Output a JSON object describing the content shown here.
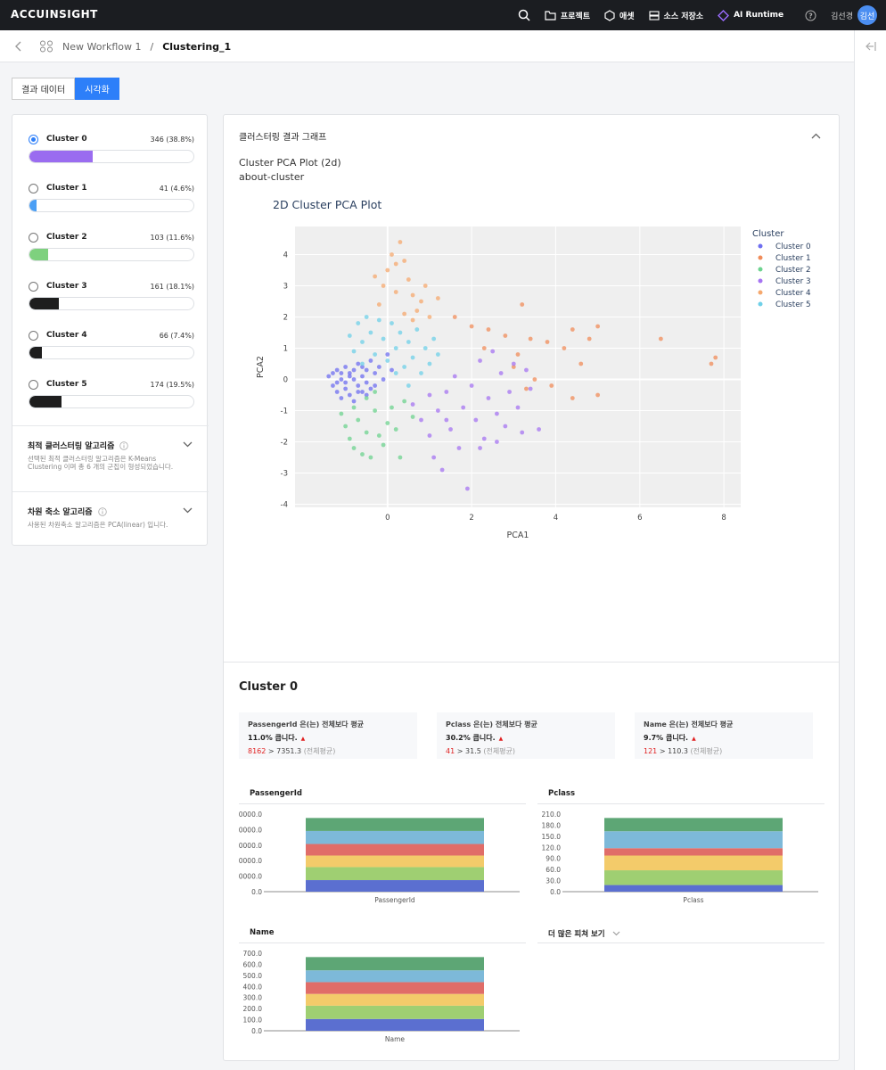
{
  "app": {
    "logo": "ACCUINSIGHT",
    "nav": [
      {
        "label": "",
        "icon": "search-icon"
      },
      {
        "label": "프로젝트",
        "icon": "folder-icon"
      },
      {
        "label": "애셋",
        "icon": "hexagon-icon"
      },
      {
        "label": "소스 저장소",
        "icon": "storage-icon"
      },
      {
        "label": "AI Runtime",
        "icon": "diamond-icon"
      }
    ],
    "user_name": "김선경",
    "user_initials": "김선"
  },
  "breadcrumb": {
    "workflow": "New Workflow 1",
    "separator": "/",
    "current": "Clustering_1"
  },
  "tabs": [
    {
      "label": "결과 데이터",
      "active": false
    },
    {
      "label": "시각화",
      "active": true
    }
  ],
  "clusters": [
    {
      "name": "Cluster 0",
      "count": "346 (38.8%)",
      "fraction": 0.388,
      "color": "#9a6cf0",
      "selected": true
    },
    {
      "name": "Cluster 1",
      "count": "41 (4.6%)",
      "fraction": 0.046,
      "color": "#4b9ff5",
      "selected": false
    },
    {
      "name": "Cluster 2",
      "count": "103 (11.6%)",
      "fraction": 0.116,
      "color": "#7ed17e",
      "selected": false
    },
    {
      "name": "Cluster 3",
      "count": "161 (18.1%)",
      "fraction": 0.181,
      "color": "#1e1e1e",
      "selected": false
    },
    {
      "name": "Cluster 4",
      "count": "66 (7.4%)",
      "fraction": 0.074,
      "color": "#1e1e1e",
      "selected": false
    },
    {
      "name": "Cluster 5",
      "count": "174 (19.5%)",
      "fraction": 0.195,
      "color": "#1e1e1e",
      "selected": false
    }
  ],
  "sections": [
    {
      "title": "최적 클러스터링 알고리즘",
      "desc": "선택된 최적 클러스터링 알고리즘은 K-Means Clustering 이며 총 6 개의 군집이 형성되었습니다."
    },
    {
      "title": "차원 축소 알고리즘",
      "desc": "사용된 차원축소 알고리즘은 PCA(linear) 입니다."
    }
  ],
  "main": {
    "header": "클러스터링 결과 그래프",
    "plot_name": "Cluster PCA Plot (2d)",
    "plot_id": "about-cluster"
  },
  "cluster_detail": {
    "title": "Cluster 0",
    "stats": [
      {
        "feature": "PassengerId 은(는) 전체보다 평균",
        "pct": "11.0% 큽니다.",
        "value": "8162",
        "rest": " > 7351.3 ",
        "avg_label": "(전체평균)"
      },
      {
        "feature": "Pclass 은(는) 전체보다 평균",
        "pct": "30.2% 큽니다.",
        "value": "41",
        "rest": " > 31.5 ",
        "avg_label": "(전체평균)"
      },
      {
        "feature": "Name 은(는) 전체보다 평균",
        "pct": "9.7% 큽니다.",
        "value": "121",
        "rest": " > 110.3 ",
        "avg_label": "(전체평균)"
      }
    ],
    "more_features": "더 많은 피쳐 보기"
  },
  "chart_data": [
    {
      "type": "scatter",
      "title": "2D Cluster PCA Plot",
      "xlabel": "PCA1",
      "ylabel": "PCA2",
      "xlim": [
        -2.2,
        8.4
      ],
      "ylim": [
        -4.1,
        4.9
      ],
      "xticks": [
        0,
        2,
        4,
        6,
        8
      ],
      "yticks": [
        -4,
        -3,
        -2,
        -1,
        0,
        1,
        2,
        3,
        4
      ],
      "legend_title": "Cluster",
      "legend_position": "right",
      "series": [
        {
          "name": "Cluster 0",
          "color": "#6f6ff0",
          "points": [
            [
              -1.4,
              0.1
            ],
            [
              -1.3,
              -0.2
            ],
            [
              -1.2,
              0.3
            ],
            [
              -1.2,
              -0.4
            ],
            [
              -1.1,
              0.0
            ],
            [
              -1.1,
              -0.6
            ],
            [
              -1.0,
              0.4
            ],
            [
              -1.0,
              -0.3
            ],
            [
              -0.9,
              0.2
            ],
            [
              -0.9,
              -0.5
            ],
            [
              -0.8,
              0.0
            ],
            [
              -0.8,
              -0.7
            ],
            [
              -0.7,
              0.5
            ],
            [
              -0.7,
              -0.2
            ],
            [
              -0.6,
              0.1
            ],
            [
              -0.6,
              -0.4
            ],
            [
              -0.5,
              0.3
            ],
            [
              -0.5,
              -0.1
            ],
            [
              -0.4,
              0.6
            ],
            [
              -0.4,
              -0.3
            ],
            [
              -0.3,
              0.2
            ],
            [
              -0.2,
              0.4
            ],
            [
              -0.1,
              0.0
            ],
            [
              0.0,
              0.8
            ],
            [
              0.1,
              0.3
            ],
            [
              -1.3,
              0.2
            ],
            [
              -1.2,
              -0.1
            ],
            [
              -1.1,
              0.2
            ],
            [
              -1.0,
              -0.1
            ],
            [
              -0.9,
              0.1
            ],
            [
              -0.8,
              0.3
            ],
            [
              -0.7,
              -0.4
            ],
            [
              -0.6,
              0.4
            ],
            [
              -0.5,
              -0.5
            ],
            [
              -0.3,
              -0.2
            ]
          ]
        },
        {
          "name": "Cluster 1",
          "color": "#f08c5a",
          "points": [
            [
              1.6,
              2.0
            ],
            [
              2.0,
              1.7
            ],
            [
              2.4,
              1.6
            ],
            [
              2.8,
              1.4
            ],
            [
              3.2,
              2.4
            ],
            [
              3.4,
              1.3
            ],
            [
              3.8,
              1.2
            ],
            [
              4.2,
              1.0
            ],
            [
              4.4,
              1.6
            ],
            [
              4.6,
              0.5
            ],
            [
              4.8,
              1.3
            ],
            [
              5.0,
              1.7
            ],
            [
              5.0,
              -0.5
            ],
            [
              4.4,
              -0.6
            ],
            [
              3.9,
              -0.2
            ],
            [
              3.5,
              0.0
            ],
            [
              3.3,
              -0.3
            ],
            [
              3.0,
              0.4
            ],
            [
              6.5,
              1.3
            ],
            [
              7.7,
              0.5
            ],
            [
              7.8,
              0.7
            ],
            [
              2.3,
              1.0
            ],
            [
              3.1,
              0.8
            ]
          ]
        },
        {
          "name": "Cluster 2",
          "color": "#6dd38f",
          "points": [
            [
              -1.1,
              -1.1
            ],
            [
              -1.0,
              -1.5
            ],
            [
              -0.9,
              -1.9
            ],
            [
              -0.8,
              -2.2
            ],
            [
              -0.7,
              -1.3
            ],
            [
              -0.6,
              -2.4
            ],
            [
              -0.5,
              -1.7
            ],
            [
              -0.4,
              -2.5
            ],
            [
              -0.3,
              -1.0
            ],
            [
              -0.2,
              -1.8
            ],
            [
              -0.1,
              -2.1
            ],
            [
              0.0,
              -1.4
            ],
            [
              0.1,
              -0.9
            ],
            [
              0.2,
              -1.6
            ],
            [
              0.4,
              -0.7
            ],
            [
              -0.8,
              -0.9
            ],
            [
              -0.5,
              -0.6
            ],
            [
              -0.3,
              -0.4
            ],
            [
              0.3,
              -2.5
            ],
            [
              0.6,
              -1.2
            ]
          ]
        },
        {
          "name": "Cluster 3",
          "color": "#a674f2",
          "points": [
            [
              0.6,
              -0.8
            ],
            [
              0.8,
              -1.3
            ],
            [
              1.0,
              -1.8
            ],
            [
              1.1,
              -2.5
            ],
            [
              1.2,
              -1.0
            ],
            [
              1.3,
              -2.9
            ],
            [
              1.4,
              -0.4
            ],
            [
              1.5,
              -1.6
            ],
            [
              1.6,
              0.1
            ],
            [
              1.7,
              -2.2
            ],
            [
              1.8,
              -0.9
            ],
            [
              1.9,
              -3.5
            ],
            [
              2.0,
              -0.2
            ],
            [
              2.1,
              -1.3
            ],
            [
              2.2,
              0.6
            ],
            [
              2.3,
              -1.9
            ],
            [
              2.4,
              -0.6
            ],
            [
              2.5,
              0.9
            ],
            [
              2.6,
              -1.1
            ],
            [
              2.7,
              0.2
            ],
            [
              2.8,
              -1.5
            ],
            [
              2.9,
              -0.4
            ],
            [
              3.0,
              0.5
            ],
            [
              3.1,
              -0.9
            ],
            [
              3.2,
              -1.7
            ],
            [
              3.4,
              -0.3
            ],
            [
              3.6,
              -1.6
            ],
            [
              3.3,
              0.3
            ],
            [
              2.2,
              -2.2
            ],
            [
              1.0,
              -0.5
            ],
            [
              1.4,
              -1.3
            ],
            [
              2.6,
              -2.0
            ]
          ]
        },
        {
          "name": "Cluster 4",
          "color": "#f5a86e",
          "points": [
            [
              -0.1,
              3.0
            ],
            [
              0.0,
              3.5
            ],
            [
              0.1,
              4.0
            ],
            [
              0.2,
              3.7
            ],
            [
              0.3,
              4.4
            ],
            [
              0.4,
              3.8
            ],
            [
              0.5,
              3.2
            ],
            [
              0.6,
              2.7
            ],
            [
              0.7,
              2.2
            ],
            [
              0.8,
              2.5
            ],
            [
              0.9,
              3.0
            ],
            [
              1.0,
              2.0
            ],
            [
              0.2,
              2.8
            ],
            [
              -0.2,
              2.4
            ],
            [
              0.4,
              2.1
            ],
            [
              1.2,
              2.6
            ],
            [
              0.6,
              1.9
            ],
            [
              -0.3,
              3.3
            ]
          ]
        },
        {
          "name": "Cluster 5",
          "color": "#6fd0e8",
          "points": [
            [
              -0.9,
              1.4
            ],
            [
              -0.8,
              0.9
            ],
            [
              -0.7,
              1.8
            ],
            [
              -0.6,
              1.2
            ],
            [
              -0.5,
              2.0
            ],
            [
              -0.4,
              1.5
            ],
            [
              -0.3,
              0.8
            ],
            [
              -0.2,
              1.9
            ],
            [
              -0.1,
              1.3
            ],
            [
              0.0,
              0.6
            ],
            [
              0.1,
              1.8
            ],
            [
              0.2,
              1.0
            ],
            [
              0.3,
              1.5
            ],
            [
              0.4,
              0.4
            ],
            [
              0.5,
              1.2
            ],
            [
              0.6,
              0.7
            ],
            [
              0.7,
              1.6
            ],
            [
              0.8,
              0.2
            ],
            [
              0.9,
              1.0
            ],
            [
              1.0,
              0.5
            ],
            [
              1.1,
              1.3
            ],
            [
              1.2,
              0.8
            ],
            [
              -0.6,
              0.5
            ],
            [
              0.5,
              -0.2
            ],
            [
              0.2,
              0.2
            ]
          ]
        }
      ]
    },
    {
      "type": "bar",
      "title": "PassengerId",
      "xlabel": "PassengerId",
      "categories": [
        "PassengerId"
      ],
      "yticks": [
        "0.0",
        "0000.0",
        "0000.0",
        "0000.0",
        "0000.0",
        "0000.0"
      ],
      "stacked": true,
      "colors": [
        "#5b6fd0",
        "#9fcf72",
        "#f3cb6a",
        "#e06d68",
        "#7db9d9",
        "#5da675"
      ],
      "series_fraction": [
        0.16,
        0.18,
        0.16,
        0.16,
        0.18,
        0.18
      ]
    },
    {
      "type": "bar",
      "title": "Pclass",
      "xlabel": "Pclass",
      "categories": [
        "Pclass"
      ],
      "yticks": [
        "0.0",
        "30.0",
        "60.0",
        "90.0",
        "120.0",
        "150.0",
        "180.0",
        "210.0"
      ],
      "stacked": true,
      "colors": [
        "#5b6fd0",
        "#9fcf72",
        "#f3cb6a",
        "#e06d68",
        "#7db9d9",
        "#5da675"
      ],
      "series_fraction": [
        0.09,
        0.2,
        0.2,
        0.1,
        0.23,
        0.18
      ]
    },
    {
      "type": "bar",
      "title": "Name",
      "xlabel": "Name",
      "categories": [
        "Name"
      ],
      "yticks": [
        "0.0",
        "100.0",
        "200.0",
        "300.0",
        "400.0",
        "500.0",
        "600.0",
        "700.0"
      ],
      "stacked": true,
      "colors": [
        "#5b6fd0",
        "#9fcf72",
        "#f3cb6a",
        "#e06d68",
        "#7db9d9",
        "#5da675"
      ],
      "series_fraction": [
        0.16,
        0.18,
        0.16,
        0.16,
        0.16,
        0.18
      ]
    }
  ]
}
